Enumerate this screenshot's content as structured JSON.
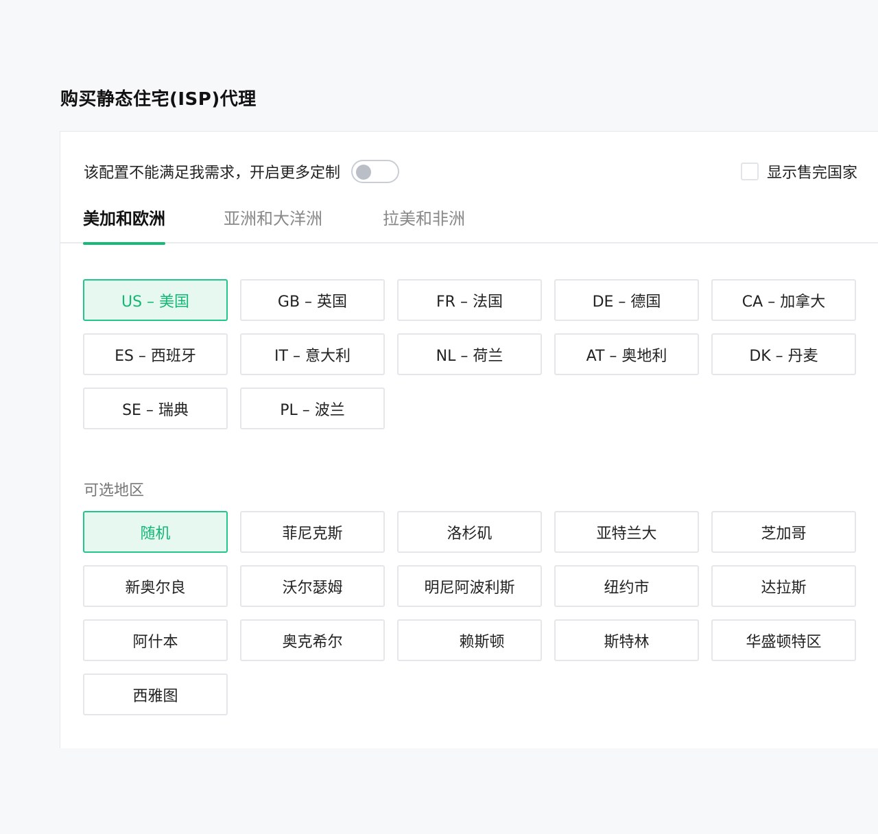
{
  "page_title": "购买静态住宅(ISP)代理",
  "customize": {
    "text": "该配置不能满足我需求，开启更多定制",
    "toggle_on": false
  },
  "show_sold_out": {
    "label": "显示售完国家",
    "checked": false
  },
  "tabs": [
    {
      "label": "美加和欧洲",
      "active": true
    },
    {
      "label": "亚洲和大洋洲",
      "active": false
    },
    {
      "label": "拉美和非洲",
      "active": false
    }
  ],
  "countries": [
    {
      "label": "US – 美国",
      "selected": true
    },
    {
      "label": "GB – 英国",
      "selected": false
    },
    {
      "label": "FR – 法国",
      "selected": false
    },
    {
      "label": "DE – 德国",
      "selected": false
    },
    {
      "label": "CA – 加拿大",
      "selected": false
    },
    {
      "label": "ES – 西班牙",
      "selected": false
    },
    {
      "label": "IT – 意大利",
      "selected": false
    },
    {
      "label": "NL – 荷兰",
      "selected": false
    },
    {
      "label": "AT – 奥地利",
      "selected": false
    },
    {
      "label": "DK – 丹麦",
      "selected": false
    },
    {
      "label": "SE – 瑞典",
      "selected": false
    },
    {
      "label": "PL – 波兰",
      "selected": false
    }
  ],
  "regions_label": "可选地区",
  "regions": [
    {
      "label": "随机",
      "selected": true
    },
    {
      "label": "菲尼克斯",
      "selected": false
    },
    {
      "label": "洛杉矶",
      "selected": false
    },
    {
      "label": "亚特兰大",
      "selected": false
    },
    {
      "label": "芝加哥",
      "selected": false
    },
    {
      "label": "新奥尔良",
      "selected": false
    },
    {
      "label": "沃尔瑟姆",
      "selected": false
    },
    {
      "label": "明尼阿波利斯",
      "selected": false
    },
    {
      "label": "纽约市",
      "selected": false
    },
    {
      "label": "达拉斯",
      "selected": false
    },
    {
      "label": "阿什本",
      "selected": false
    },
    {
      "label": "奥克希尔",
      "selected": false
    },
    {
      "label": "赖斯顿",
      "selected": false
    },
    {
      "label": "斯特林",
      "selected": false
    },
    {
      "label": "华盛顿特区",
      "selected": false
    },
    {
      "label": "西雅图",
      "selected": false
    }
  ],
  "colors": {
    "accent": "#17b978",
    "selected_bg": "#e7f8f0",
    "selected_border": "#22c58a"
  }
}
